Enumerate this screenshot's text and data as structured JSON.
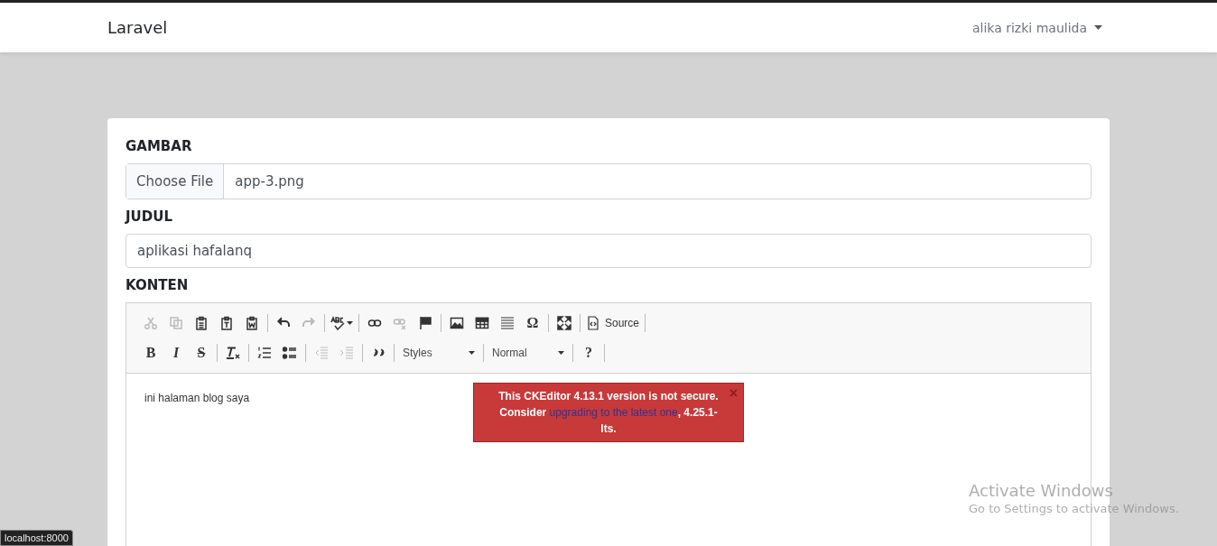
{
  "navbar": {
    "brand": "Laravel",
    "user": "alika rizki maulida"
  },
  "form": {
    "image_label": "GAMBAR",
    "file_button": "Choose File",
    "file_name": "app-3.png",
    "title_label": "JUDUL",
    "title_value": "aplikasi hafalanq",
    "content_label": "KONTEN"
  },
  "toolbar": {
    "rows": [
      [
        [
          {
            "kind": "button",
            "disabled": true
          },
          {
            "kind": "button",
            "disabled": true
          },
          {
            "kind": "button",
            "disabled": false
          },
          {
            "kind": "button",
            "disabled": false
          },
          {
            "kind": "button",
            "disabled": false
          }
        ],
        [
          {
            "kind": "button",
            "disabled": false
          },
          {
            "kind": "button",
            "disabled": true
          }
        ],
        [
          {
            "kind": "menu",
            "disabled": false
          }
        ],
        [
          {
            "kind": "button",
            "disabled": false
          },
          {
            "kind": "button",
            "disabled": true
          },
          {
            "kind": "button",
            "disabled": false
          }
        ],
        [
          {
            "kind": "button",
            "disabled": false
          },
          {
            "kind": "button",
            "disabled": false
          },
          {
            "kind": "button",
            "disabled": false
          },
          {
            "kind": "glyph",
            "glyph": "Ω",
            "disabled": false
          }
        ],
        [
          {
            "kind": "button",
            "disabled": false
          }
        ],
        [
          {
            "kind": "labeled",
            "label": "Source",
            "disabled": false
          }
        ]
      ],
      [
        [
          {
            "kind": "glyph",
            "glyph": "B",
            "disabled": false
          },
          {
            "kind": "glyph",
            "glyph": "I",
            "disabled": false
          },
          {
            "kind": "glyph",
            "glyph": "S",
            "disabled": false
          }
        ],
        [
          {
            "kind": "button",
            "disabled": false
          }
        ],
        [
          {
            "kind": "button",
            "disabled": false
          },
          {
            "kind": "button",
            "disabled": false
          }
        ],
        [
          {
            "kind": "button",
            "disabled": true
          },
          {
            "kind": "button",
            "disabled": true
          }
        ],
        [
          {
            "kind": "button",
            "disabled": false
          }
        ],
        [
          {
            "kind": "combo",
            "label": "Styles",
            "disabled": false
          }
        ],
        [
          {
            "kind": "combo",
            "label": "Normal",
            "disabled": false
          }
        ],
        [
          {
            "kind": "glyph",
            "glyph": "?",
            "disabled": false
          }
        ]
      ]
    ]
  },
  "editor": {
    "content": "ini halaman blog saya"
  },
  "notification": {
    "text_before": "This CKEditor 4.13.1 version is not secure. Consider ",
    "link": "upgrading to the latest one",
    "text_after": ", 4.25.1-lts.",
    "close": "×"
  },
  "os_overlay": {
    "title": "Activate Windows",
    "subtitle": "Go to Settings to activate Windows."
  },
  "status_url": "localhost:8000"
}
